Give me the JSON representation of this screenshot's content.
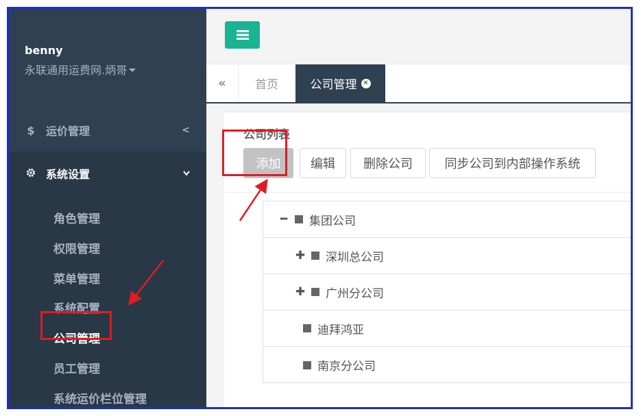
{
  "user": {
    "name": "benny",
    "org": "永联通用运费网.炳哥"
  },
  "sidebar": {
    "sections": [
      {
        "icon": "$",
        "label": "运价管理"
      },
      {
        "icon": "gear",
        "label": "系统设置"
      }
    ],
    "sub_items": [
      "角色管理",
      "权限管理",
      "菜单管理",
      "系统配置",
      "公司管理",
      "员工管理",
      "系统运价栏位管理"
    ]
  },
  "tabs": {
    "home": "首页",
    "active": "公司管理"
  },
  "card": {
    "title": "公司列表",
    "buttons": {
      "add": "添加",
      "edit": "编辑",
      "delete": "删除公司",
      "sync": "同步公司到内部操作系统"
    }
  },
  "tree": [
    {
      "label": "集团公司",
      "toggle": "minus"
    },
    {
      "label": "深圳总公司",
      "toggle": "plus"
    },
    {
      "label": "广州分公司",
      "toggle": "plus"
    },
    {
      "label": "迪拜鸿亚",
      "toggle": "none"
    },
    {
      "label": "南京分公司",
      "toggle": "none"
    }
  ],
  "colors": {
    "sidebar": "#2f4050",
    "accent": "#1ab394",
    "highlight": "#e01b24",
    "frame": "#1a2fc7"
  }
}
